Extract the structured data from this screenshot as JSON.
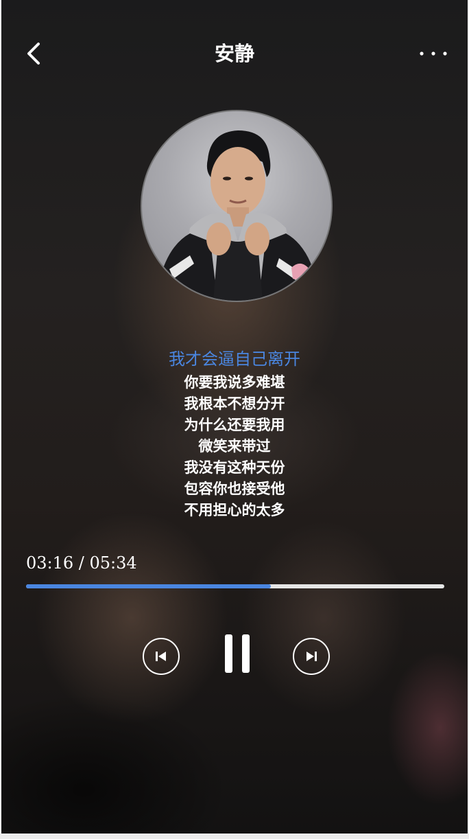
{
  "header": {
    "title": "安静",
    "back_icon": "chevron-left-icon",
    "more_icon": "more-horizontal-icon"
  },
  "cover": {
    "icon": "album-cover-artist-photo"
  },
  "lyrics": {
    "current": "我才会逼自己离开",
    "lines": [
      "你要我说多难堪",
      "我根本不想分开",
      "为什么还要我用",
      "微笑来带过",
      "我没有这种天份",
      "包容你也接受他",
      "不用担心的太多"
    ]
  },
  "player": {
    "time_display": "03:16 / 05:34",
    "progress_fraction": 0.586,
    "prev_icon": "skip-previous-icon",
    "pause_icon": "pause-icon",
    "next_icon": "skip-next-icon"
  },
  "colors": {
    "accent": "#4a86e0",
    "track": "#e6e6e6",
    "text": "#ffffff"
  }
}
